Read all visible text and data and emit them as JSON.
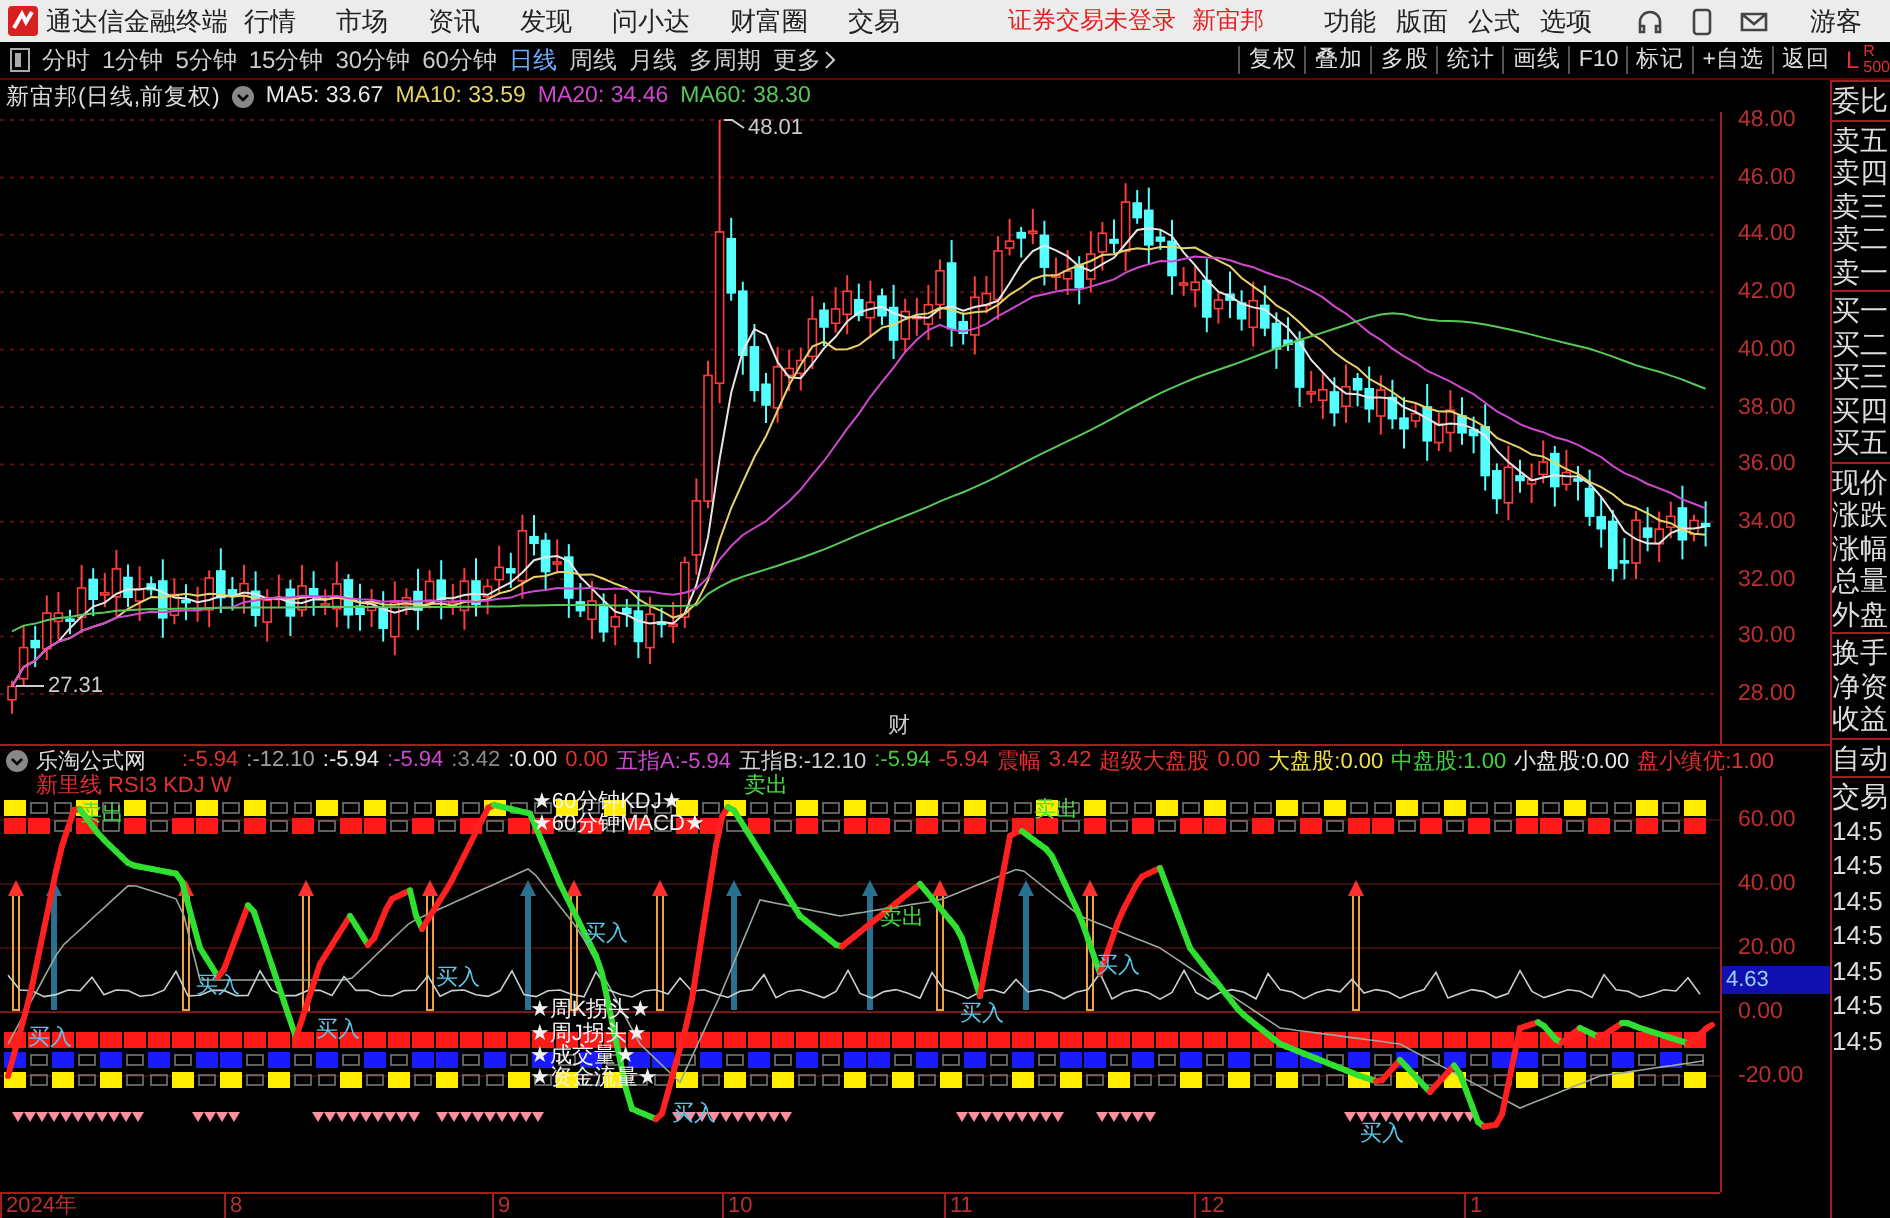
{
  "menubar": {
    "app_title": "通达信金融终端",
    "menus": [
      "行情",
      "市场",
      "资讯",
      "发现",
      "问小达",
      "财富圈",
      "交易"
    ],
    "status": [
      "证券交易未登录",
      "新宙邦"
    ],
    "actions": [
      "功能",
      "版面",
      "公式",
      "选项"
    ],
    "user": "游客"
  },
  "toolbar": {
    "periods": [
      {
        "label": "分时",
        "selected": false
      },
      {
        "label": "1分钟",
        "selected": false
      },
      {
        "label": "5分钟",
        "selected": false
      },
      {
        "label": "15分钟",
        "selected": false
      },
      {
        "label": "30分钟",
        "selected": false
      },
      {
        "label": "60分钟",
        "selected": false
      },
      {
        "label": "日线",
        "selected": true
      },
      {
        "label": "周线",
        "selected": false
      },
      {
        "label": "月线",
        "selected": false
      },
      {
        "label": "多周期",
        "selected": false
      }
    ],
    "more": "更多",
    "tools": [
      "复权",
      "叠加",
      "多股",
      "统计",
      "画线",
      "F10",
      "标记",
      "+自选",
      "返回"
    ],
    "corner": [
      "L",
      "R",
      "500"
    ]
  },
  "price_chart": {
    "title": "新宙邦(日线,前复权)",
    "mas": [
      {
        "label": "MA5: 33.67",
        "color": "#e6e6e6"
      },
      {
        "label": "MA10: 33.59",
        "color": "#e8d36a"
      },
      {
        "label": "MA20: 34.46",
        "color": "#d048d0"
      },
      {
        "label": "MA60: 38.30",
        "color": "#58c858"
      }
    ],
    "yticks": [
      "48.00",
      "46.00",
      "44.00",
      "42.00",
      "40.00",
      "38.00",
      "36.00",
      "34.00",
      "32.00",
      "30.00",
      "28.00"
    ],
    "annotations": [
      "48.01",
      "27.31",
      "财"
    ]
  },
  "indicator": {
    "name": "乐淘公式网",
    "values": [
      {
        "text": ":-5.94",
        "color": "#e03030"
      },
      {
        "text": ":-12.10",
        "color": "#a0a0a0"
      },
      {
        "text": ":-5.94",
        "color": "#e6e6e6"
      },
      {
        "text": ":-5.94",
        "color": "#d048d0"
      },
      {
        "text": ":3.42",
        "color": "#8a8a8a"
      },
      {
        "text": ":0.00",
        "color": "#e6e6e6"
      },
      {
        "text": "0.00",
        "color": "#e03030"
      },
      {
        "text": "五指A:-5.94",
        "color": "#d048d0"
      },
      {
        "text": "五指B:-12.10",
        "color": "#d0d0d0"
      },
      {
        "text": ":-5.94",
        "color": "#40d040"
      },
      {
        "text": "-5.94",
        "color": "#e03030"
      },
      {
        "text": "震幅",
        "color": "#e03030"
      },
      {
        "text": "3.42",
        "color": "#e03030"
      },
      {
        "text": "超级大盘股",
        "color": "#e03030"
      },
      {
        "text": "0.00",
        "color": "#e03030"
      },
      {
        "text": "大盘股:0.00",
        "color": "#f0e040"
      },
      {
        "text": "中盘股:1.00",
        "color": "#40d040"
      },
      {
        "text": "小盘股:0.00",
        "color": "#e6e6e6"
      },
      {
        "text": "盘小缜优:1.00",
        "color": "#e03030"
      }
    ],
    "labels": [
      {
        "text": "新里线 RSI3 KDJ W",
        "kind": "title"
      },
      {
        "text": "卖出",
        "kind": "sell"
      },
      {
        "text": "★60分钟KDJ★",
        "kind": "star"
      },
      {
        "text": "★60分钟MACD★",
        "kind": "star"
      },
      {
        "text": "卖出",
        "kind": "sell"
      },
      {
        "text": "卖出",
        "kind": "sell"
      },
      {
        "text": "卖出",
        "kind": "sell"
      },
      {
        "text": "买入",
        "kind": "buy"
      },
      {
        "text": "买入",
        "kind": "buy"
      },
      {
        "text": "买入",
        "kind": "buy"
      },
      {
        "text": "买入",
        "kind": "buy"
      },
      {
        "text": "买入",
        "kind": "buy"
      },
      {
        "text": "买入",
        "kind": "buy"
      },
      {
        "text": "买入",
        "kind": "buy"
      },
      {
        "text": "买入",
        "kind": "buy"
      },
      {
        "text": "买入",
        "kind": "buy"
      },
      {
        "text": "★周K拐头★",
        "kind": "star"
      },
      {
        "text": "★周J拐头★",
        "kind": "star"
      },
      {
        "text": "★成交量★",
        "kind": "star"
      },
      {
        "text": "★资金流量★",
        "kind": "star"
      }
    ],
    "yticks": [
      "60.00",
      "40.00",
      "20.00",
      "0.00",
      "-20.00"
    ],
    "reading": "4.63"
  },
  "date_axis": [
    "2024年",
    "8",
    "9",
    "10",
    "11",
    "12",
    "1"
  ],
  "side_panel": {
    "quote_groups": [
      [
        "委比"
      ],
      [
        "卖五",
        "卖四",
        "卖三",
        "卖二",
        "卖一"
      ],
      [
        "买一",
        "买二",
        "买三",
        "买四",
        "买五"
      ],
      [
        "现价",
        "涨跌",
        "涨幅",
        "总量",
        "外盘"
      ],
      [
        "换手",
        "净资",
        "收益"
      ]
    ],
    "tabs": [
      "自动",
      "交易"
    ],
    "times": [
      "14:5",
      "14:5",
      "14:5",
      "14:5",
      "14:5",
      "14:5",
      "14:5"
    ]
  }
}
